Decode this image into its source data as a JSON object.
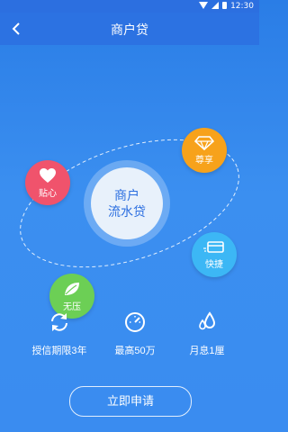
{
  "status_bar": {
    "time": "12:30"
  },
  "nav": {
    "title": "商户贷"
  },
  "center": {
    "line1": "商户",
    "line2": "流水贷"
  },
  "badges": {
    "heart": "贴心",
    "gem": "尊享",
    "card": "快捷",
    "leaf": "无压"
  },
  "features": {
    "term": "授信期限3年",
    "max": "最高50万",
    "interest": "月息1厘"
  },
  "actions": {
    "apply": "立即申请"
  },
  "colors": {
    "accent": "#2c72e2",
    "heart": "#f0536c",
    "gem": "#f7a21b",
    "card": "#3cb7f5",
    "leaf": "#6ccf55"
  }
}
